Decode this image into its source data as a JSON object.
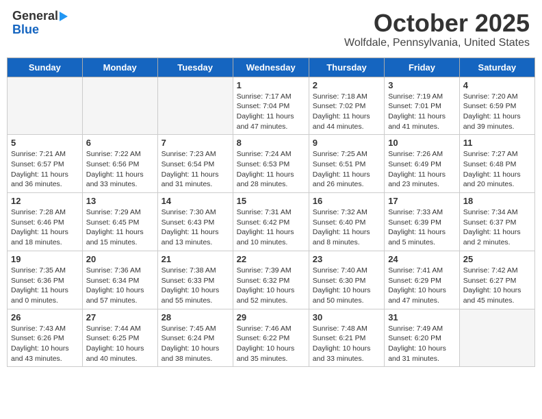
{
  "header": {
    "logo_general": "General",
    "logo_blue": "Blue",
    "month_title": "October 2025",
    "location": "Wolfdale, Pennsylvania, United States"
  },
  "days_of_week": [
    "Sunday",
    "Monday",
    "Tuesday",
    "Wednesday",
    "Thursday",
    "Friday",
    "Saturday"
  ],
  "weeks": [
    [
      {
        "day": "",
        "info": ""
      },
      {
        "day": "",
        "info": ""
      },
      {
        "day": "",
        "info": ""
      },
      {
        "day": "1",
        "info": "Sunrise: 7:17 AM\nSunset: 7:04 PM\nDaylight: 11 hours and 47 minutes."
      },
      {
        "day": "2",
        "info": "Sunrise: 7:18 AM\nSunset: 7:02 PM\nDaylight: 11 hours and 44 minutes."
      },
      {
        "day": "3",
        "info": "Sunrise: 7:19 AM\nSunset: 7:01 PM\nDaylight: 11 hours and 41 minutes."
      },
      {
        "day": "4",
        "info": "Sunrise: 7:20 AM\nSunset: 6:59 PM\nDaylight: 11 hours and 39 minutes."
      }
    ],
    [
      {
        "day": "5",
        "info": "Sunrise: 7:21 AM\nSunset: 6:57 PM\nDaylight: 11 hours and 36 minutes."
      },
      {
        "day": "6",
        "info": "Sunrise: 7:22 AM\nSunset: 6:56 PM\nDaylight: 11 hours and 33 minutes."
      },
      {
        "day": "7",
        "info": "Sunrise: 7:23 AM\nSunset: 6:54 PM\nDaylight: 11 hours and 31 minutes."
      },
      {
        "day": "8",
        "info": "Sunrise: 7:24 AM\nSunset: 6:53 PM\nDaylight: 11 hours and 28 minutes."
      },
      {
        "day": "9",
        "info": "Sunrise: 7:25 AM\nSunset: 6:51 PM\nDaylight: 11 hours and 26 minutes."
      },
      {
        "day": "10",
        "info": "Sunrise: 7:26 AM\nSunset: 6:49 PM\nDaylight: 11 hours and 23 minutes."
      },
      {
        "day": "11",
        "info": "Sunrise: 7:27 AM\nSunset: 6:48 PM\nDaylight: 11 hours and 20 minutes."
      }
    ],
    [
      {
        "day": "12",
        "info": "Sunrise: 7:28 AM\nSunset: 6:46 PM\nDaylight: 11 hours and 18 minutes."
      },
      {
        "day": "13",
        "info": "Sunrise: 7:29 AM\nSunset: 6:45 PM\nDaylight: 11 hours and 15 minutes."
      },
      {
        "day": "14",
        "info": "Sunrise: 7:30 AM\nSunset: 6:43 PM\nDaylight: 11 hours and 13 minutes."
      },
      {
        "day": "15",
        "info": "Sunrise: 7:31 AM\nSunset: 6:42 PM\nDaylight: 11 hours and 10 minutes."
      },
      {
        "day": "16",
        "info": "Sunrise: 7:32 AM\nSunset: 6:40 PM\nDaylight: 11 hours and 8 minutes."
      },
      {
        "day": "17",
        "info": "Sunrise: 7:33 AM\nSunset: 6:39 PM\nDaylight: 11 hours and 5 minutes."
      },
      {
        "day": "18",
        "info": "Sunrise: 7:34 AM\nSunset: 6:37 PM\nDaylight: 11 hours and 2 minutes."
      }
    ],
    [
      {
        "day": "19",
        "info": "Sunrise: 7:35 AM\nSunset: 6:36 PM\nDaylight: 11 hours and 0 minutes."
      },
      {
        "day": "20",
        "info": "Sunrise: 7:36 AM\nSunset: 6:34 PM\nDaylight: 10 hours and 57 minutes."
      },
      {
        "day": "21",
        "info": "Sunrise: 7:38 AM\nSunset: 6:33 PM\nDaylight: 10 hours and 55 minutes."
      },
      {
        "day": "22",
        "info": "Sunrise: 7:39 AM\nSunset: 6:32 PM\nDaylight: 10 hours and 52 minutes."
      },
      {
        "day": "23",
        "info": "Sunrise: 7:40 AM\nSunset: 6:30 PM\nDaylight: 10 hours and 50 minutes."
      },
      {
        "day": "24",
        "info": "Sunrise: 7:41 AM\nSunset: 6:29 PM\nDaylight: 10 hours and 47 minutes."
      },
      {
        "day": "25",
        "info": "Sunrise: 7:42 AM\nSunset: 6:27 PM\nDaylight: 10 hours and 45 minutes."
      }
    ],
    [
      {
        "day": "26",
        "info": "Sunrise: 7:43 AM\nSunset: 6:26 PM\nDaylight: 10 hours and 43 minutes."
      },
      {
        "day": "27",
        "info": "Sunrise: 7:44 AM\nSunset: 6:25 PM\nDaylight: 10 hours and 40 minutes."
      },
      {
        "day": "28",
        "info": "Sunrise: 7:45 AM\nSunset: 6:24 PM\nDaylight: 10 hours and 38 minutes."
      },
      {
        "day": "29",
        "info": "Sunrise: 7:46 AM\nSunset: 6:22 PM\nDaylight: 10 hours and 35 minutes."
      },
      {
        "day": "30",
        "info": "Sunrise: 7:48 AM\nSunset: 6:21 PM\nDaylight: 10 hours and 33 minutes."
      },
      {
        "day": "31",
        "info": "Sunrise: 7:49 AM\nSunset: 6:20 PM\nDaylight: 10 hours and 31 minutes."
      },
      {
        "day": "",
        "info": ""
      }
    ]
  ]
}
